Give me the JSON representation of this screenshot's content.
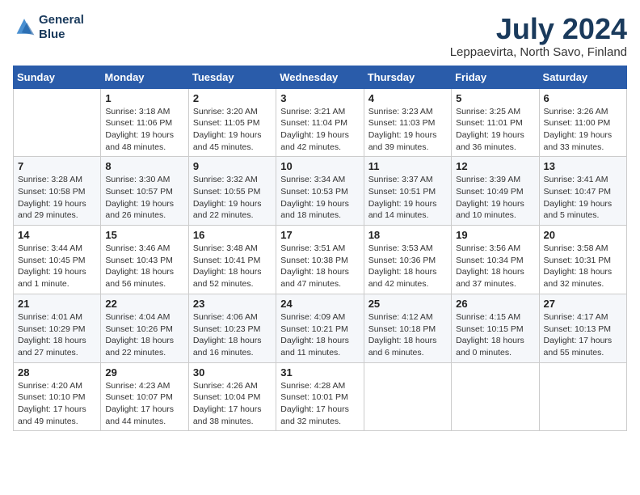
{
  "header": {
    "logo_line1": "General",
    "logo_line2": "Blue",
    "month": "July 2024",
    "location": "Leppaevirta, North Savo, Finland"
  },
  "weekdays": [
    "Sunday",
    "Monday",
    "Tuesday",
    "Wednesday",
    "Thursday",
    "Friday",
    "Saturday"
  ],
  "weeks": [
    [
      {
        "day": "",
        "info": ""
      },
      {
        "day": "1",
        "info": "Sunrise: 3:18 AM\nSunset: 11:06 PM\nDaylight: 19 hours\nand 48 minutes."
      },
      {
        "day": "2",
        "info": "Sunrise: 3:20 AM\nSunset: 11:05 PM\nDaylight: 19 hours\nand 45 minutes."
      },
      {
        "day": "3",
        "info": "Sunrise: 3:21 AM\nSunset: 11:04 PM\nDaylight: 19 hours\nand 42 minutes."
      },
      {
        "day": "4",
        "info": "Sunrise: 3:23 AM\nSunset: 11:03 PM\nDaylight: 19 hours\nand 39 minutes."
      },
      {
        "day": "5",
        "info": "Sunrise: 3:25 AM\nSunset: 11:01 PM\nDaylight: 19 hours\nand 36 minutes."
      },
      {
        "day": "6",
        "info": "Sunrise: 3:26 AM\nSunset: 11:00 PM\nDaylight: 19 hours\nand 33 minutes."
      }
    ],
    [
      {
        "day": "7",
        "info": "Sunrise: 3:28 AM\nSunset: 10:58 PM\nDaylight: 19 hours\nand 29 minutes."
      },
      {
        "day": "8",
        "info": "Sunrise: 3:30 AM\nSunset: 10:57 PM\nDaylight: 19 hours\nand 26 minutes."
      },
      {
        "day": "9",
        "info": "Sunrise: 3:32 AM\nSunset: 10:55 PM\nDaylight: 19 hours\nand 22 minutes."
      },
      {
        "day": "10",
        "info": "Sunrise: 3:34 AM\nSunset: 10:53 PM\nDaylight: 19 hours\nand 18 minutes."
      },
      {
        "day": "11",
        "info": "Sunrise: 3:37 AM\nSunset: 10:51 PM\nDaylight: 19 hours\nand 14 minutes."
      },
      {
        "day": "12",
        "info": "Sunrise: 3:39 AM\nSunset: 10:49 PM\nDaylight: 19 hours\nand 10 minutes."
      },
      {
        "day": "13",
        "info": "Sunrise: 3:41 AM\nSunset: 10:47 PM\nDaylight: 19 hours\nand 5 minutes."
      }
    ],
    [
      {
        "day": "14",
        "info": "Sunrise: 3:44 AM\nSunset: 10:45 PM\nDaylight: 19 hours\nand 1 minute."
      },
      {
        "day": "15",
        "info": "Sunrise: 3:46 AM\nSunset: 10:43 PM\nDaylight: 18 hours\nand 56 minutes."
      },
      {
        "day": "16",
        "info": "Sunrise: 3:48 AM\nSunset: 10:41 PM\nDaylight: 18 hours\nand 52 minutes."
      },
      {
        "day": "17",
        "info": "Sunrise: 3:51 AM\nSunset: 10:38 PM\nDaylight: 18 hours\nand 47 minutes."
      },
      {
        "day": "18",
        "info": "Sunrise: 3:53 AM\nSunset: 10:36 PM\nDaylight: 18 hours\nand 42 minutes."
      },
      {
        "day": "19",
        "info": "Sunrise: 3:56 AM\nSunset: 10:34 PM\nDaylight: 18 hours\nand 37 minutes."
      },
      {
        "day": "20",
        "info": "Sunrise: 3:58 AM\nSunset: 10:31 PM\nDaylight: 18 hours\nand 32 minutes."
      }
    ],
    [
      {
        "day": "21",
        "info": "Sunrise: 4:01 AM\nSunset: 10:29 PM\nDaylight: 18 hours\nand 27 minutes."
      },
      {
        "day": "22",
        "info": "Sunrise: 4:04 AM\nSunset: 10:26 PM\nDaylight: 18 hours\nand 22 minutes."
      },
      {
        "day": "23",
        "info": "Sunrise: 4:06 AM\nSunset: 10:23 PM\nDaylight: 18 hours\nand 16 minutes."
      },
      {
        "day": "24",
        "info": "Sunrise: 4:09 AM\nSunset: 10:21 PM\nDaylight: 18 hours\nand 11 minutes."
      },
      {
        "day": "25",
        "info": "Sunrise: 4:12 AM\nSunset: 10:18 PM\nDaylight: 18 hours\nand 6 minutes."
      },
      {
        "day": "26",
        "info": "Sunrise: 4:15 AM\nSunset: 10:15 PM\nDaylight: 18 hours\nand 0 minutes."
      },
      {
        "day": "27",
        "info": "Sunrise: 4:17 AM\nSunset: 10:13 PM\nDaylight: 17 hours\nand 55 minutes."
      }
    ],
    [
      {
        "day": "28",
        "info": "Sunrise: 4:20 AM\nSunset: 10:10 PM\nDaylight: 17 hours\nand 49 minutes."
      },
      {
        "day": "29",
        "info": "Sunrise: 4:23 AM\nSunset: 10:07 PM\nDaylight: 17 hours\nand 44 minutes."
      },
      {
        "day": "30",
        "info": "Sunrise: 4:26 AM\nSunset: 10:04 PM\nDaylight: 17 hours\nand 38 minutes."
      },
      {
        "day": "31",
        "info": "Sunrise: 4:28 AM\nSunset: 10:01 PM\nDaylight: 17 hours\nand 32 minutes."
      },
      {
        "day": "",
        "info": ""
      },
      {
        "day": "",
        "info": ""
      },
      {
        "day": "",
        "info": ""
      }
    ]
  ]
}
